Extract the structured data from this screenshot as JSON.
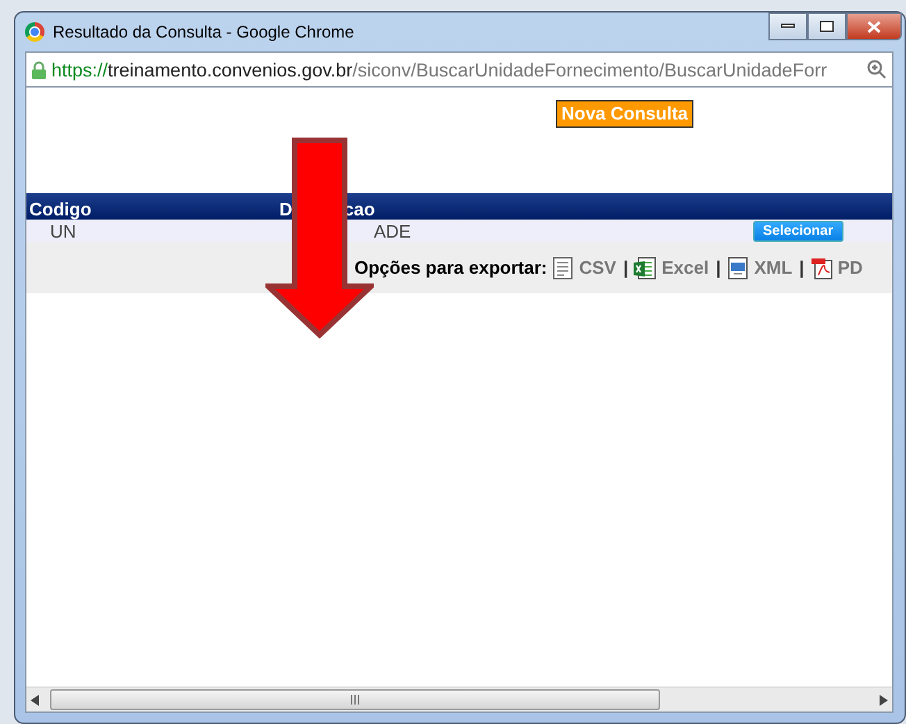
{
  "window": {
    "title": "Resultado da Consulta - Google Chrome"
  },
  "address_bar": {
    "scheme": "https",
    "separator": "://",
    "host": "treinamento.convenios.gov.br",
    "path": "/siconv/BuscarUnidadeFornecimento/BuscarUnidadeForr"
  },
  "new_query_button": "Nova Consulta",
  "table": {
    "columns": [
      {
        "label": "Codigo"
      },
      {
        "label_start": "D",
        "label_end": "cao"
      }
    ],
    "rows": [
      {
        "cells": [
          "UN",
          "ADE"
        ],
        "action": "Selecionar"
      }
    ]
  },
  "export": {
    "label": "Opções para exportar:",
    "options": [
      {
        "kind": "csv",
        "label": "CSV"
      },
      {
        "kind": "excel",
        "label": "Excel",
        "separator": "|"
      },
      {
        "kind": "xml",
        "label": "XML",
        "separator": "|"
      },
      {
        "kind": "pdf",
        "label": "PD",
        "separator": "|"
      }
    ]
  }
}
